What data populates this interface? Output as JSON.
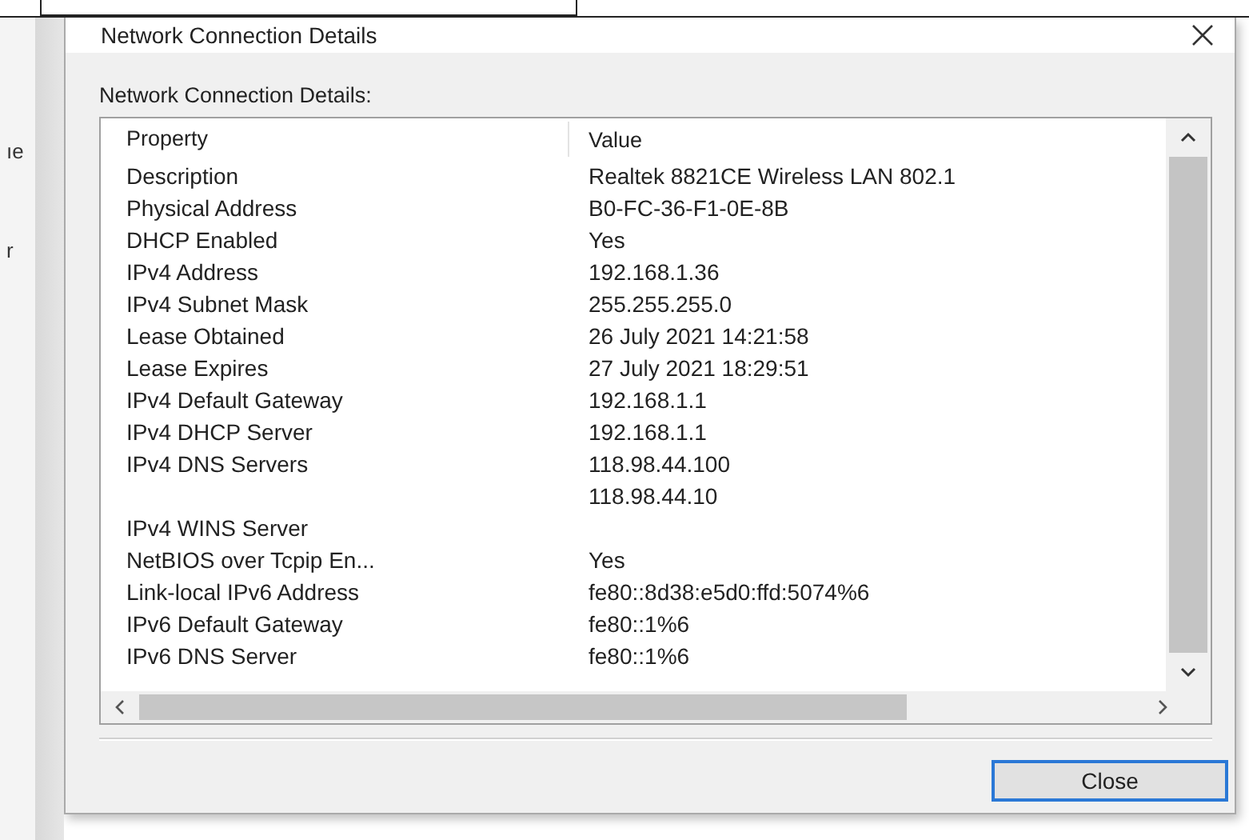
{
  "background_window": {
    "fragments": [
      "ıe",
      "r"
    ]
  },
  "window": {
    "title": "Network Connection Details"
  },
  "group_label": "Network Connection Details:",
  "table": {
    "columns": [
      "Property",
      "Value"
    ],
    "rows": [
      [
        "Description",
        "Realtek 8821CE Wireless LAN 802.1"
      ],
      [
        "Physical Address",
        "B0-FC-36-F1-0E-8B"
      ],
      [
        "DHCP Enabled",
        "Yes"
      ],
      [
        "IPv4 Address",
        "192.168.1.36"
      ],
      [
        "IPv4 Subnet Mask",
        "255.255.255.0"
      ],
      [
        "Lease Obtained",
        "26 July 2021 14:21:58"
      ],
      [
        "Lease Expires",
        "27 July 2021 18:29:51"
      ],
      [
        "IPv4 Default Gateway",
        "192.168.1.1"
      ],
      [
        "IPv4 DHCP Server",
        "192.168.1.1"
      ],
      [
        "IPv4 DNS Servers",
        "118.98.44.100"
      ],
      [
        "",
        "118.98.44.10"
      ],
      [
        "IPv4 WINS Server",
        ""
      ],
      [
        "NetBIOS over Tcpip En...",
        "Yes"
      ],
      [
        "Link-local IPv6 Address",
        "fe80::8d38:e5d0:ffd:5074%6"
      ],
      [
        "IPv6 Default Gateway",
        "fe80::1%6"
      ],
      [
        "IPv6 DNS Server",
        "fe80::1%6"
      ]
    ]
  },
  "buttons": [
    "Close"
  ]
}
